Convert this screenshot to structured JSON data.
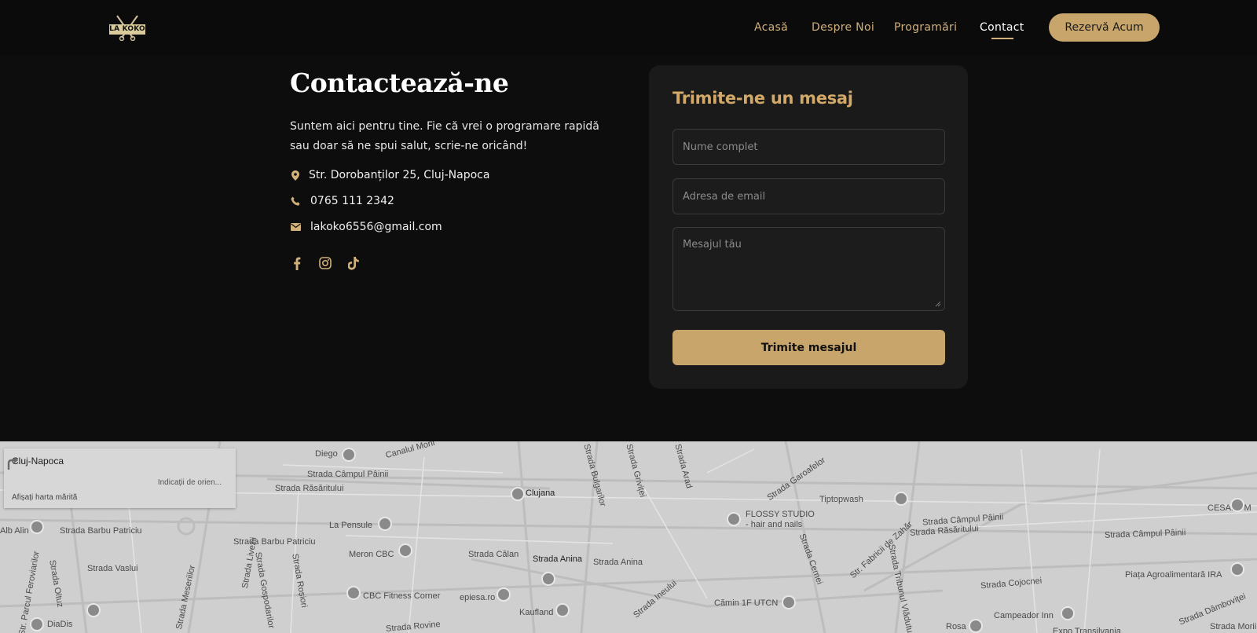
{
  "brand": {
    "logo_text": "LA KOKO"
  },
  "nav": {
    "links": [
      {
        "label": "Acasă"
      },
      {
        "label": "Despre Noi"
      },
      {
        "label": "Programări"
      },
      {
        "label": "Contact"
      }
    ],
    "active": "Contact",
    "cta_label": "Rezervă Acum"
  },
  "contact": {
    "title": "Contactează-ne",
    "description": "Suntem aici pentru tine. Fie că vrei o programare rapidă sau doar să ne spui salut, scrie-ne oricând!",
    "address": "Str. Dorobanților 25, Cluj-Napoca",
    "phone": "0765 111 2342",
    "email": "lakoko6556@gmail.com",
    "socials": [
      "facebook-icon",
      "instagram-icon",
      "tiktok-icon"
    ]
  },
  "form": {
    "title": "Trimite-ne un mesaj",
    "name_placeholder": "Nume complet",
    "email_placeholder": "Adresa de email",
    "message_placeholder": "Mesajul tău",
    "name_value": "",
    "email_value": "",
    "message_value": "",
    "submit_label": "Trimite mesajul"
  },
  "map": {
    "place_name": "Cluj-Napoca",
    "directions_label": "Indicații de orien...",
    "larger_map_label": "Afișați harta mărită",
    "labels": [
      "Diego",
      "Canalul Morii",
      "Strada Câmpul Pâinii",
      "Strada Răsăritului",
      "Clujana",
      "La Pensule",
      "Alb Alin",
      "Strada Barbu Patriciu",
      "Strada Barbu Patriciu",
      "Meron CBC",
      "Strada Călan",
      "Strada Anina",
      "Strada Anina",
      "Strada Vaslui",
      "Strada Oltuz",
      "Strada Livezii",
      "Strada Gospodarilor",
      "Strada Roșiori",
      "Strada Meseriilor",
      "CBC Fitness Corner",
      "epiesa.ro",
      "Kaufland",
      "DiaDis",
      "Strada Rovine",
      "Str. Parcul Feroviarilor",
      "FLOSSY STUDIO",
      "- hair and nails",
      "Tiptopwash",
      "Strada Garoafelor",
      "Strada Câmpul Pâinii",
      "Strada Răsăritului",
      "Strada Cernei",
      "Str. Fabricii de Zahăr",
      "Strada Tribunul Vlădutu",
      "Cămin 1F UTCN",
      "Strada Cojocnei",
      "Campeador Inn",
      "Rosa",
      "CESAROM",
      "Strada Câmpul Pâinii",
      "Piața Agroalimentară IRA",
      "Strada Dâmboviței",
      "Expo Transilvania",
      "Strada Bulgarilor",
      "Strada Griviței",
      "Strada Arad",
      "Strada Ineului",
      "Strada Morii"
    ]
  },
  "colors": {
    "background": "#0d0d0d",
    "accent": "#c8a66b",
    "accent_text": "#d2a968",
    "card": "#1a1a1a",
    "map": "#cfcfcf"
  }
}
